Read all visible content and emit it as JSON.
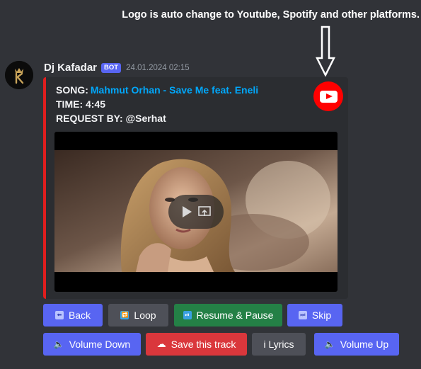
{
  "annotation": {
    "text": "Logo is auto change to Youtube, Spotify and other platforms."
  },
  "message": {
    "author": "Dj Kafadar",
    "badge": "BOT",
    "timestamp": "24.01.2024 02:15"
  },
  "embed": {
    "accent_color": "#e01e1e",
    "song_label": "SONG:",
    "song_title": "Mahmut Orhan - Save Me feat. Eneli",
    "time_label": "TIME:",
    "time_value": "4:45",
    "request_label": "REQUEST BY:",
    "request_value": "@Serhat",
    "platform_icon": "youtube-icon"
  },
  "buttons_row1": [
    {
      "label": "Back",
      "icon": "back-arrow-icon",
      "color": "#5865f2"
    },
    {
      "label": "Loop",
      "icon": "loop-icon",
      "color": "#4e5058"
    },
    {
      "label": "Resume & Pause",
      "icon": "play-pause-icon",
      "color": "#248046"
    },
    {
      "label": "Skip",
      "icon": "skip-icon",
      "color": "#5865f2"
    }
  ],
  "buttons_row2": [
    {
      "label": "Volume Down",
      "icon": "speaker-icon",
      "color": "#5865f2"
    },
    {
      "label": "Save this track",
      "icon": "cloud-icon",
      "color": "#da373c"
    },
    {
      "label": "i Lyrics",
      "icon": "",
      "color": "#4e5058"
    },
    {
      "label": "Volume Up",
      "icon": "speaker-icon",
      "color": "#5865f2"
    }
  ]
}
